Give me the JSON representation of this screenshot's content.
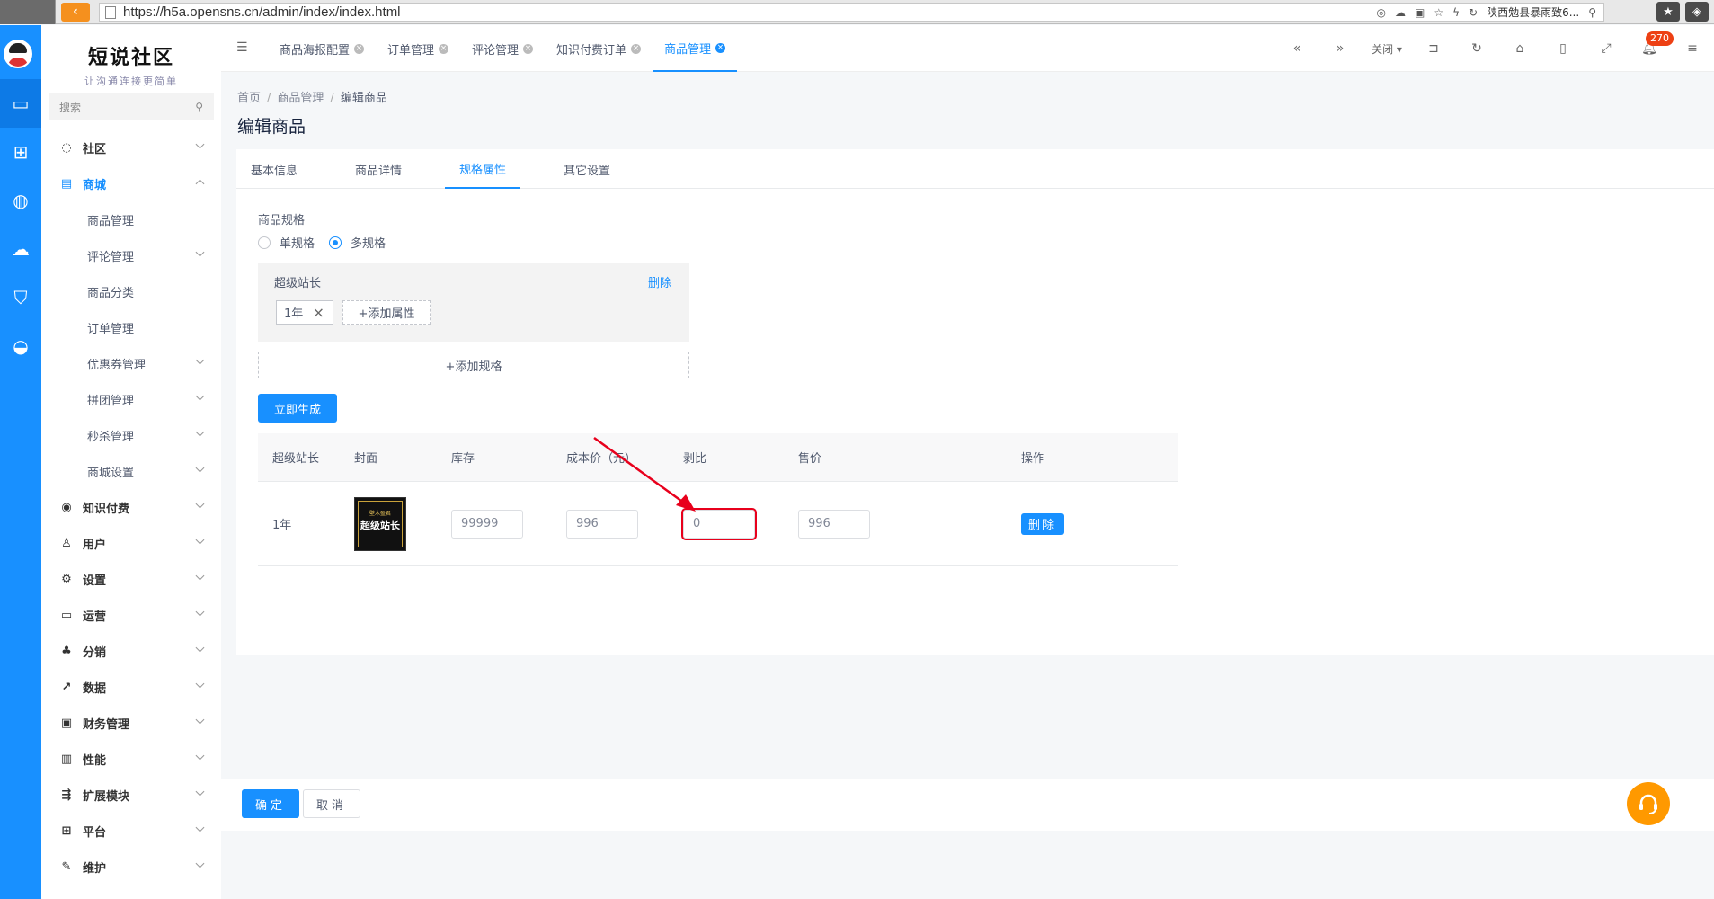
{
  "browser": {
    "url": "https://h5a.opensns.cn/admin/index/index.html",
    "search_text": "陕西勉县暴雨致6..."
  },
  "sidebar": {
    "logo_title": "短说社区",
    "logo_subtitle": "让沟通连接更简单",
    "search_placeholder": "搜索",
    "groups": [
      {
        "label": "社区",
        "icon": "chat-bubble-icon"
      },
      {
        "label": "商城",
        "icon": "shop-icon"
      },
      {
        "label": "知识付费",
        "icon": "location-pin-icon"
      },
      {
        "label": "用户",
        "icon": "user-icon"
      },
      {
        "label": "设置",
        "icon": "gear-icon"
      },
      {
        "label": "运营",
        "icon": "monitor-icon"
      },
      {
        "label": "分销",
        "icon": "org-tree-icon"
      },
      {
        "label": "数据",
        "icon": "line-chart-icon"
      },
      {
        "label": "财务管理",
        "icon": "finance-icon"
      },
      {
        "label": "性能",
        "icon": "performance-icon"
      },
      {
        "label": "扩展模块",
        "icon": "extension-icon"
      },
      {
        "label": "平台",
        "icon": "platform-icon"
      },
      {
        "label": "维护",
        "icon": "wrench-icon"
      }
    ],
    "shop_items": [
      "商品管理",
      "评论管理",
      "商品分类",
      "订单管理",
      "优惠券管理",
      "拼团管理",
      "秒杀管理",
      "商城设置"
    ]
  },
  "topbar": {
    "tabs": [
      "商品海报配置",
      "订单管理",
      "评论管理",
      "知识付费订单",
      "商品管理"
    ],
    "close_label": "关闭",
    "notification_count": "270"
  },
  "content": {
    "breadcrumb": [
      "首页",
      "商品管理",
      "编辑商品"
    ],
    "page_title": "编辑商品",
    "form_tabs": [
      "基本信息",
      "商品详情",
      "规格属性",
      "其它设置"
    ],
    "spec_label": "商品规格",
    "radio_single": "单规格",
    "radio_multi": "多规格",
    "spec_group_name": "超级站长",
    "spec_delete": "删除",
    "spec_tag": "1年",
    "add_attr": "+添加属性",
    "add_spec": "+添加规格",
    "generate_btn": "立即生成",
    "table_headers": [
      "超级站长",
      "封面",
      "库存",
      "成本价（元）",
      "剥比",
      "售价",
      "操作"
    ],
    "row": {
      "spec": "1年",
      "cover_small": "壁木盈君",
      "cover_big": "超级站长",
      "stock": "99999",
      "cost": "996",
      "ratio": "0",
      "price": "996",
      "delete": "删除"
    },
    "ok": "确定",
    "cancel": "取消"
  },
  "colors": {
    "primary": "#1890ff",
    "highlight": "#e8001c",
    "fab": "#ff9900"
  }
}
